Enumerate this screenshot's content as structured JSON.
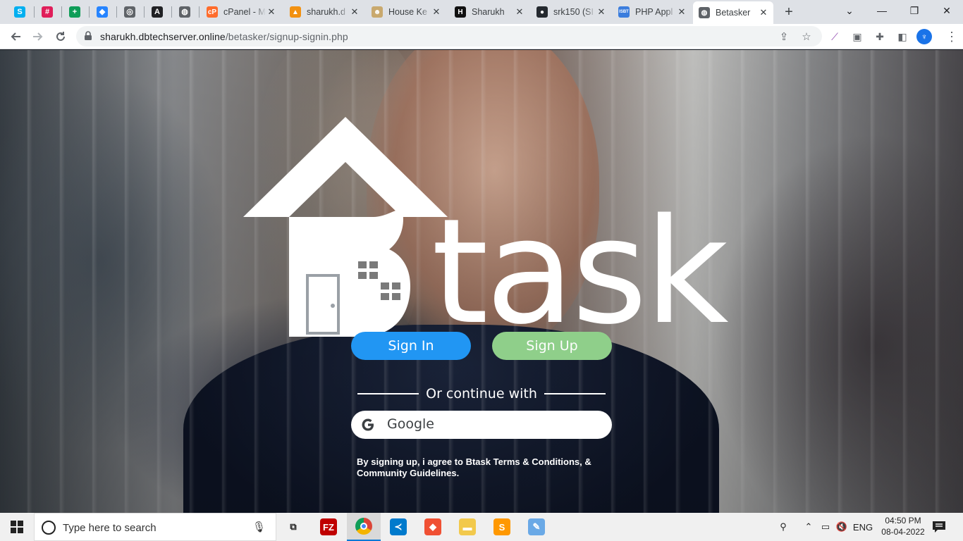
{
  "browser": {
    "pinned_tabs": [
      {
        "icon": "skype-icon",
        "glyph": "S",
        "color": "#00aff0"
      },
      {
        "icon": "slack-icon",
        "glyph": "#",
        "color": "#e01e5a"
      },
      {
        "icon": "sheets-plus-icon",
        "glyph": "+",
        "color": "#0f9d58"
      },
      {
        "icon": "jira-icon",
        "glyph": "◆",
        "color": "#2684ff"
      },
      {
        "icon": "circle-app-icon",
        "glyph": "◎",
        "color": "#5f6368"
      },
      {
        "icon": "a-app-icon",
        "glyph": "A",
        "color": "#202124"
      },
      {
        "icon": "globe-icon",
        "glyph": "◍",
        "color": "#5f6368"
      }
    ],
    "tabs": [
      {
        "title": "cPanel - M",
        "icon": "cpanel-icon",
        "color": "#ff6c2c",
        "glyph": "cP"
      },
      {
        "title": "sharukh.d",
        "icon": "phpmyadmin-icon",
        "color": "#f29111",
        "glyph": "▲"
      },
      {
        "title": "House Ke",
        "icon": "house-keeping-icon",
        "color": "#c9a96e",
        "glyph": "☻"
      },
      {
        "title": "Sharukh",
        "icon": "hostinger-icon",
        "color": "#111111",
        "glyph": "H"
      },
      {
        "title": "srk150 (SI",
        "icon": "github-icon",
        "color": "#24292f",
        "glyph": "●"
      },
      {
        "title": "PHP Appl",
        "icon": "php-app-icon",
        "color": "#3b7ddd",
        "glyph": "ISBT"
      },
      {
        "title": "Betasker",
        "icon": "globe-icon",
        "color": "#5f6368",
        "glyph": "◍",
        "active": true
      }
    ],
    "close_glyph": "✕",
    "new_tab_glyph": "+",
    "window_controls": {
      "chevron": "⌄",
      "minimize": "—",
      "restore": "❐",
      "close": "✕"
    },
    "url_host": "sharukh.dbtechserver.online",
    "url_path": "/betasker/signup-signin.php"
  },
  "page": {
    "brand": "task",
    "sign_in_label": "Sign In",
    "sign_up_label": "Sign Up",
    "divider_text": "Or continue with",
    "google_label": "Google",
    "terms_text": "By signing up, i agree to Btask Terms & Conditions, & Community Guidelines.",
    "colors": {
      "sign_in": "#2196f3",
      "sign_up": "#8fcf8a"
    }
  },
  "taskbar": {
    "search_placeholder": "Type here to search",
    "apps": [
      {
        "name": "task-view-icon",
        "glyph": "⧉",
        "color": "#222222"
      },
      {
        "name": "filezilla-icon",
        "glyph": "FZ",
        "color": "#bf0000"
      },
      {
        "name": "chrome-icon",
        "glyph": "◉",
        "color": "#db4437",
        "active": true
      },
      {
        "name": "vscode-icon",
        "glyph": "≺",
        "color": "#007acc"
      },
      {
        "name": "git-icon",
        "glyph": "◆",
        "color": "#f05033"
      },
      {
        "name": "file-explorer-icon",
        "glyph": "▬",
        "color": "#f2c94c"
      },
      {
        "name": "sublime-icon",
        "glyph": "S",
        "color": "#ff9800"
      },
      {
        "name": "paint-icon",
        "glyph": "✎",
        "color": "#6aa9e6"
      }
    ],
    "tray": {
      "language": "ENG",
      "time": "04:50 PM",
      "date": "08-04-2022"
    }
  }
}
